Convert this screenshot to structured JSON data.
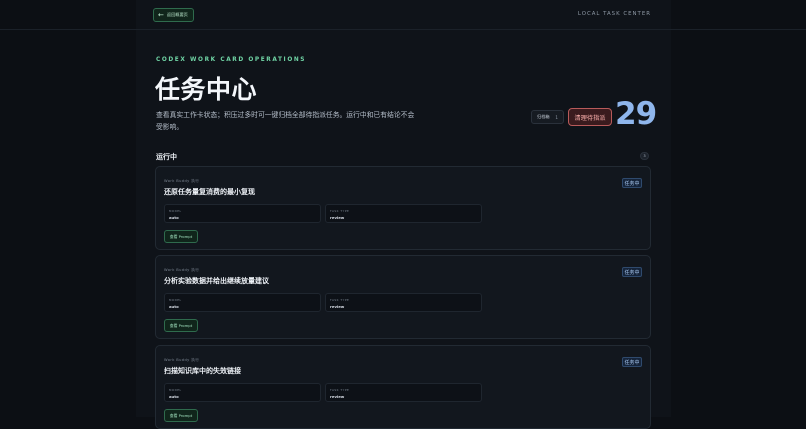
{
  "header": {
    "back_label": "返回概要页",
    "app_name": "LOCAL TASK CENTER"
  },
  "hero": {
    "eyebrow": "CODEX WORK CARD OPERATIONS",
    "title": "任务中心",
    "description": "查看真实工作卡状态；积压过多时可一键归档全部待指派任务。运行中和已有结论不会受影响。",
    "archive_label": "归档箱",
    "archive_count": "1",
    "clear_label": "清理待指派",
    "total_count": "29"
  },
  "section": {
    "title": "运行中",
    "count": "3"
  },
  "cards": [
    {
      "meta": "Work Buddy 执行",
      "title": "还原任务量复消费的最小复现",
      "status": "任务中",
      "model_label": "MODEL",
      "model_value": "auto",
      "type_label": "TASK TYPE",
      "type_value": "review",
      "prompt_label": "查看 Prompt"
    },
    {
      "meta": "Work Buddy 执行",
      "title": "分析实验数据并给出继续放量建议",
      "status": "任务中",
      "model_label": "MODEL",
      "model_value": "auto",
      "type_label": "TASK TYPE",
      "type_value": "review",
      "prompt_label": "查看 Prompt"
    },
    {
      "meta": "Work Buddy 执行",
      "title": "扫描知识库中的失效链接",
      "status": "任务中",
      "model_label": "MODEL",
      "model_value": "auto",
      "type_label": "TASK TYPE",
      "type_value": "review",
      "prompt_label": "查看 Prompt"
    }
  ]
}
